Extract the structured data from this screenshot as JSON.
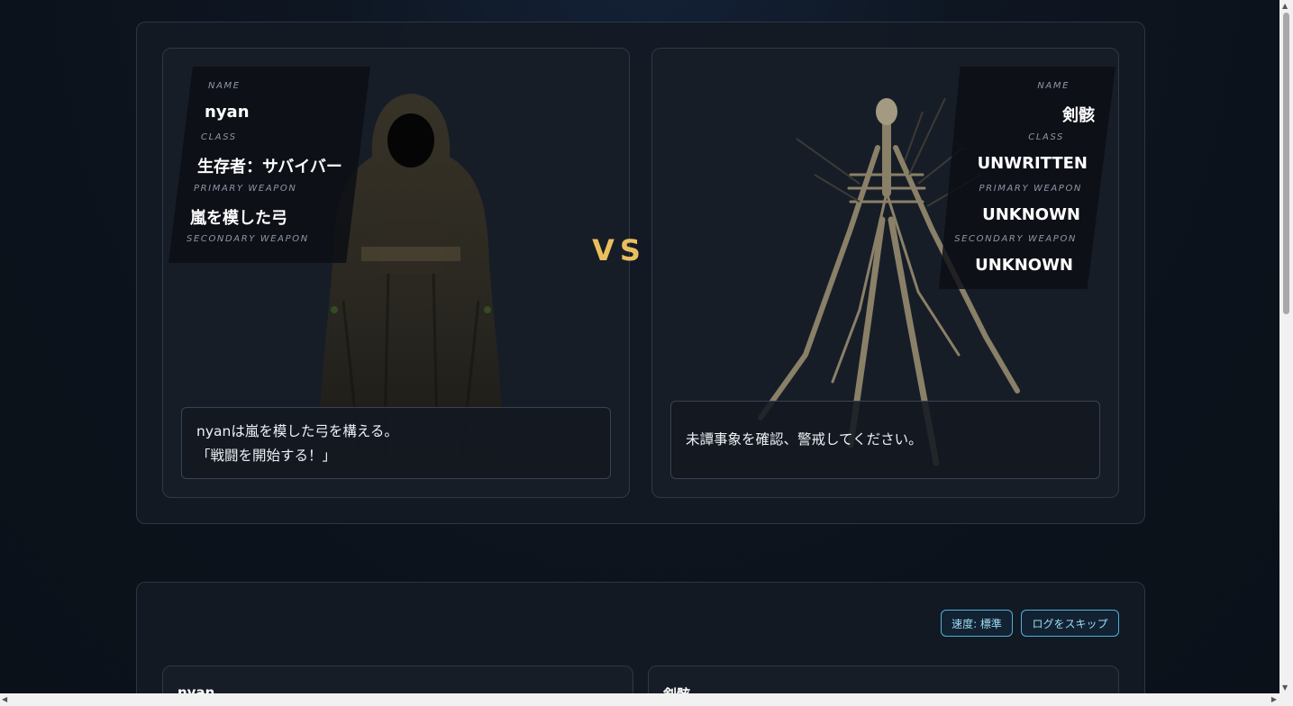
{
  "player": {
    "labels": {
      "name": "NAME",
      "class": "CLASS",
      "primary_weapon": "PRIMARY WEAPON",
      "secondary_weapon": "SECONDARY WEAPON"
    },
    "name": "nyan",
    "class": "生存者：サバイバー",
    "primary_weapon": "嵐を模した弓",
    "secondary_weapon": "",
    "speech": [
      "nyanは嵐を模した弓を構える。",
      "「戦闘を開始する！」"
    ]
  },
  "vs": "VS",
  "enemy": {
    "labels": {
      "name": "NAME",
      "class": "CLASS",
      "primary_weapon": "PRIMARY WEAPON",
      "secondary_weapon": "SECONDARY WEAPON"
    },
    "name": "剣骸",
    "class": "UNWRITTEN",
    "primary_weapon": "UNKNOWN",
    "secondary_weapon": "UNKNOWN",
    "speech": "未譚事象を確認、警戒してください。"
  },
  "controls": {
    "speed": "速度: 標準",
    "skip": "ログをスキップ"
  },
  "log": {
    "player_name": "nyan",
    "enemy_name": "剣骸"
  },
  "colors": {
    "accent": "#e9bf5e",
    "button_border": "#4fb2d6",
    "button_text": "#9fdcf3"
  }
}
